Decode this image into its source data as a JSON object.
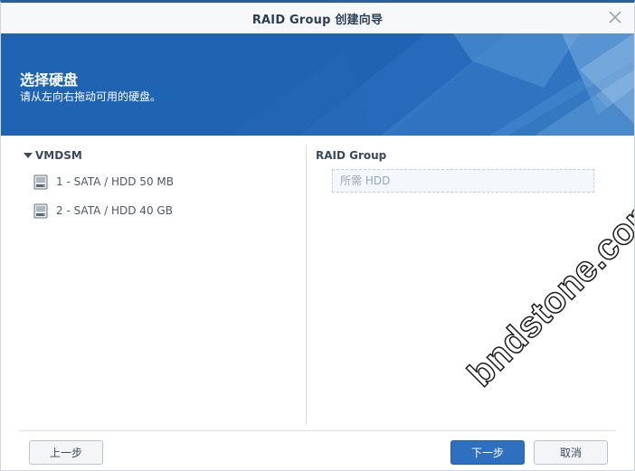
{
  "window": {
    "title": "RAID Group 创建向导",
    "close_icon": "close-icon"
  },
  "banner": {
    "heading": "选择硬盘",
    "subheading": "请从左向右拖动可用的硬盘。",
    "color": "#1f63b3"
  },
  "available_disks": {
    "group_label": "VMDSM",
    "items": [
      {
        "label": "1 - SATA / HDD 50 MB",
        "icon": "hard-disk-icon"
      },
      {
        "label": "2 - SATA / HDD 40 GB",
        "icon": "hard-disk-icon"
      }
    ]
  },
  "raid_group": {
    "label": "RAID Group",
    "dropzone_placeholder": "所需 HDD"
  },
  "footer": {
    "back_label": "上一步",
    "next_label": "下一步",
    "cancel_label": "取消",
    "accent": "#2f6fc0"
  },
  "watermark": "bndstone.com"
}
